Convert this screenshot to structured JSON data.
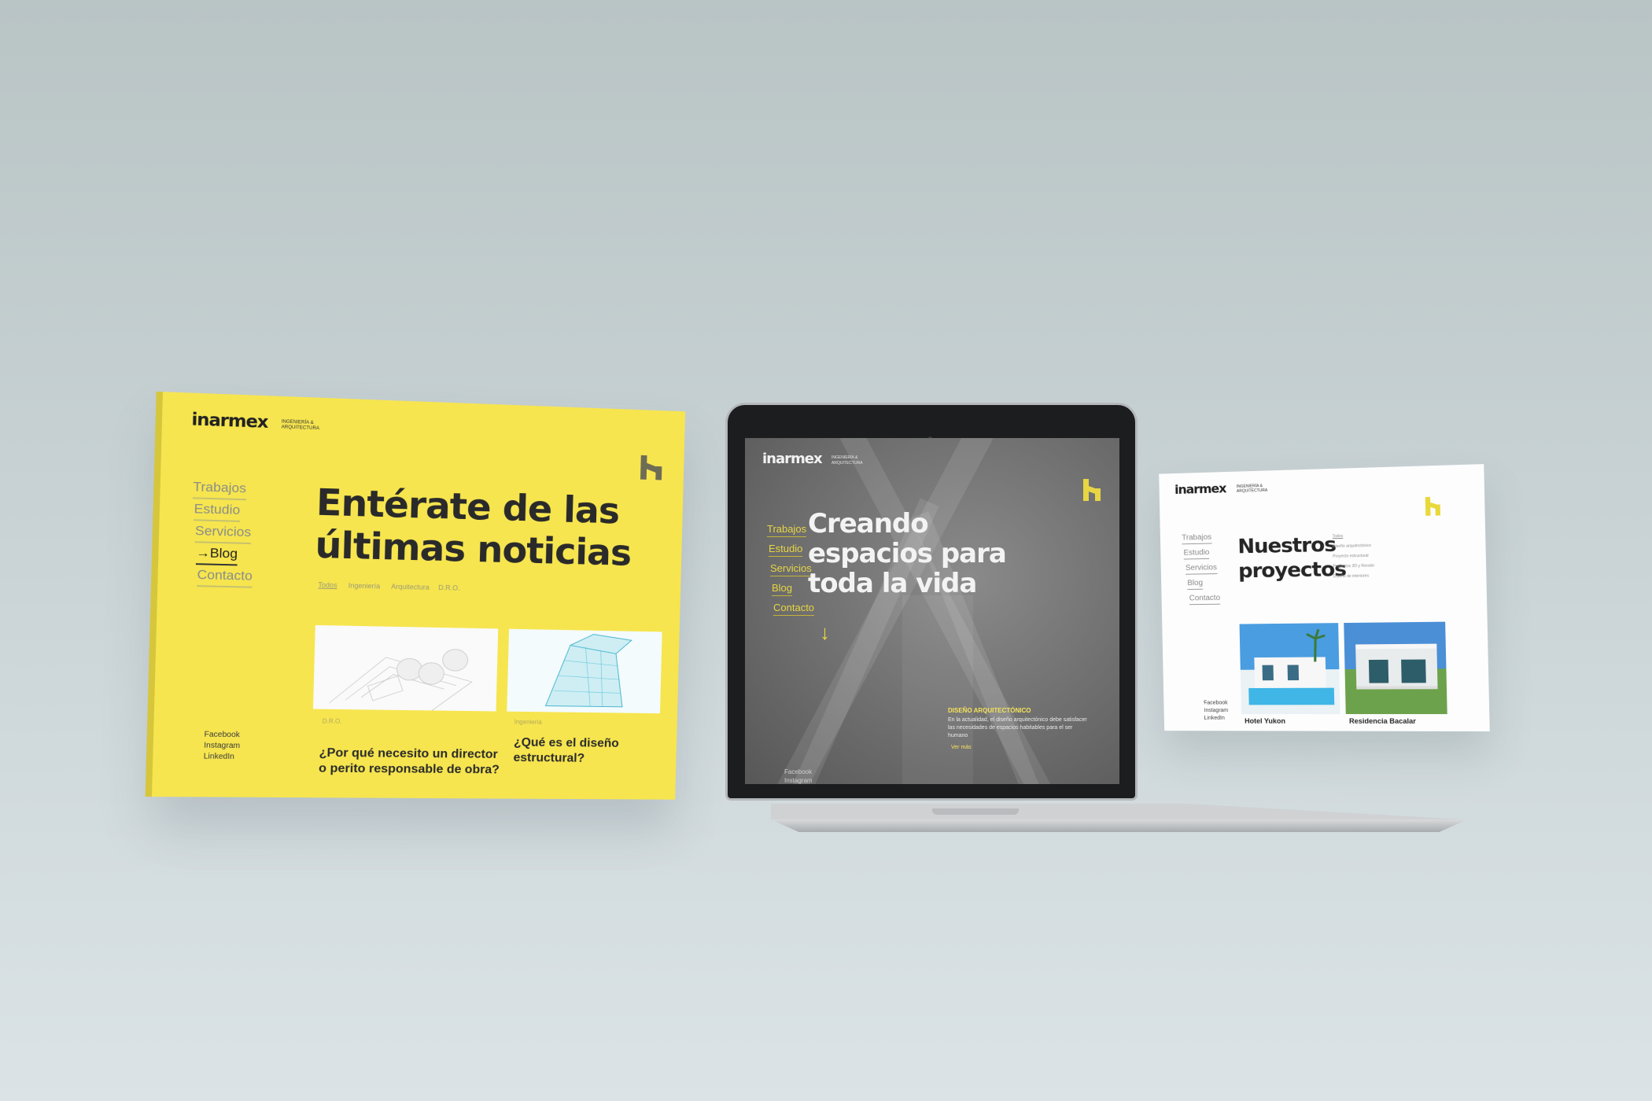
{
  "brand": {
    "name": "inarmex",
    "tagline_line1": "INGENIERÍA &",
    "tagline_line2": "ARQUITECTURA"
  },
  "colors": {
    "accent_yellow": "#f6e54f",
    "text_dark": "#2a2a2a",
    "screen_gray": "#6e6e6e"
  },
  "left_panel": {
    "nav": [
      {
        "label": "Trabajos",
        "active": false
      },
      {
        "label": "Estudio",
        "active": false
      },
      {
        "label": "Servicios",
        "active": false
      },
      {
        "label": "→Blog",
        "active": true
      },
      {
        "label": "Contacto",
        "active": false
      }
    ],
    "title_line1": "Entérate de las",
    "title_line2": "últimas noticias",
    "filters": [
      "Todos",
      "Ingeniería",
      "Arquitectura",
      "D.R.O."
    ],
    "social": [
      "Facebook",
      "Instagram",
      "LinkedIn"
    ],
    "articles": [
      {
        "category": "D.R.O.",
        "title_line1": "¿Por qué necesito un director",
        "title_line2": "o perito responsable de obra?"
      },
      {
        "category": "Ingeniería",
        "title_line1": "¿Qué es el diseño estructural?",
        "title_line2": ""
      }
    ]
  },
  "laptop_screen": {
    "nav": [
      "Trabajos",
      "Estudio",
      "Servicios",
      "Blog",
      "Contacto"
    ],
    "title_line1": "Creando",
    "title_line2": "espacios para",
    "title_line3": "toda la vida",
    "section_heading": "DISEÑO ARQUITECTÓNICO",
    "section_body": "En la actualidad, el diseño arquitectónico debe satisfacer las necesidades de espacios habitables para el ser humano",
    "more_link": "Ver más",
    "social": [
      "Facebook",
      "Instagram"
    ]
  },
  "right_panel": {
    "nav": [
      "Trabajos",
      "Estudio",
      "Servicios",
      "Blog",
      "Contacto"
    ],
    "title_line1": "Nuestros",
    "title_line2": "proyectos",
    "filters": [
      "Todos",
      "Diseño arquitectónico",
      "Proyecto estructural",
      "Proyectos 3D y Render",
      "Diseño de interiores"
    ],
    "social": [
      "Facebook",
      "Instagram",
      "LinkedIn"
    ],
    "projects": [
      {
        "name": "Hotel Yukon"
      },
      {
        "name": "Residencia Bacalar"
      }
    ]
  }
}
